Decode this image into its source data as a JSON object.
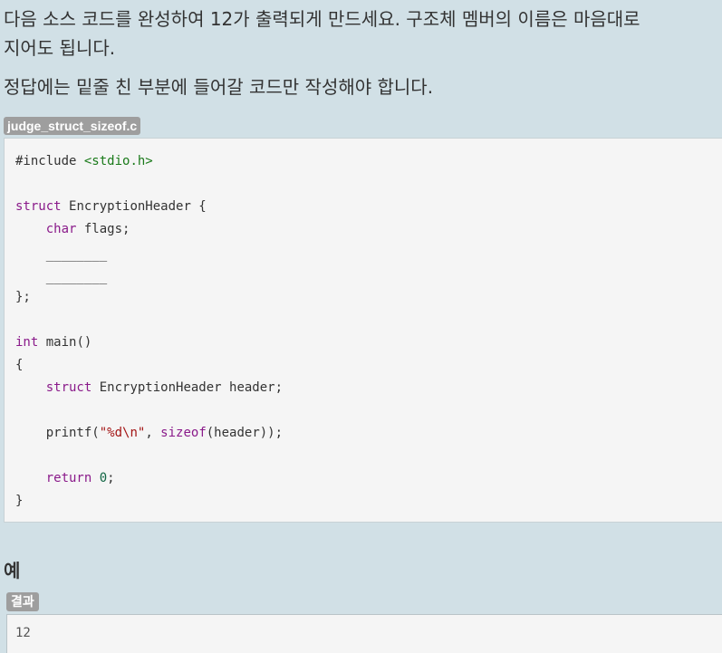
{
  "instructions": {
    "line1": "다음 소스 코드를 완성하여 12가 출력되게 만드세요. 구조체 멤버의 이름은 마음대로",
    "line2": "지어도 됩니다.",
    "line3": "정답에는 밑줄 친 부분에 들어갈 코드만 작성해야 합니다."
  },
  "file": {
    "name": "judge_struct_sizeof.c"
  },
  "code": {
    "include_directive": "#include",
    "include_header": "<stdio.h>",
    "struct_keyword": "struct",
    "struct_name": "EncryptionHeader {",
    "char_keyword": "char",
    "member_flags": "flags;",
    "blank1": "________",
    "blank2": "________",
    "struct_close": "};",
    "int_keyword": "int",
    "main_sig": "main()",
    "open_brace": "{",
    "struct_keyword2": "struct",
    "decl_rest": "EncryptionHeader header;",
    "printf_fn": "printf(",
    "printf_fmt": "\"%d\\n\"",
    "comma": ", ",
    "sizeof_keyword": "sizeof",
    "sizeof_arg": "(header));",
    "return_keyword": "return",
    "return_value": "0",
    "semicolon": ";",
    "close_brace": "}"
  },
  "example": {
    "heading": "예",
    "result_label": "결과",
    "result_value": "12"
  },
  "colors": {
    "background": "#d1e0e6",
    "code_background": "#f5f5f5",
    "tag_background": "#9e9e9e",
    "keyword": "#8a1a8a",
    "string": "#a31515",
    "include_header": "#1a7a1a",
    "number": "#116644"
  }
}
